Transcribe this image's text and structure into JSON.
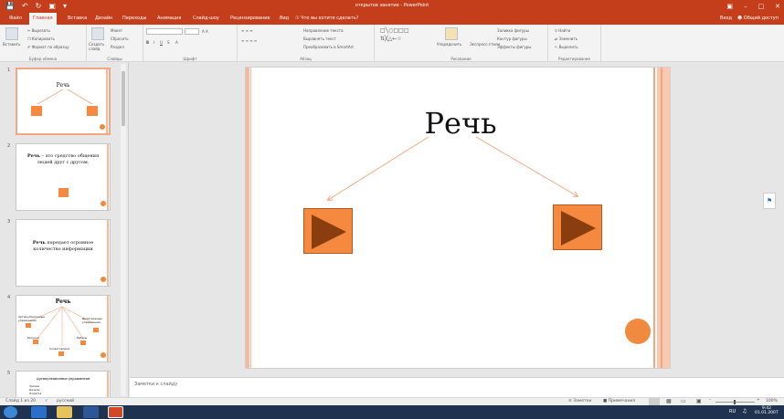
{
  "window": {
    "title": "открытое занятие - PowerPoint"
  },
  "tabs": [
    "Файл",
    "Главная",
    "Вставка",
    "Дизайн",
    "Переходы",
    "Анимация",
    "Слайд-шоу",
    "Рецензирование",
    "Вид",
    "Что вы хотите сделать?"
  ],
  "account": {
    "signin": "Вход",
    "share": "Общий доступ"
  },
  "ribbon": {
    "clipboard": {
      "paste": "Вставить",
      "cut": "Вырезать",
      "copy": "Копировать",
      "format": "Формат по образцу",
      "label": "Буфер обмена"
    },
    "slides": {
      "new_slide": "Создать слайд",
      "layout": "Макет",
      "reset": "Сбросить",
      "section": "Раздел",
      "label": "Слайды"
    },
    "font": {
      "label": "Шрифт"
    },
    "paragraph": {
      "text_dir": "Направление текста",
      "align": "Выровнять текст",
      "smartart": "Преобразовать в SmartArt",
      "label": "Абзац"
    },
    "drawing": {
      "arrange": "Упорядочить",
      "styles": "Экспресс-стили",
      "fill": "Заливка фигуры",
      "outline": "Контур фигуры",
      "effects": "Эффекты фигуры",
      "label": "Рисование"
    },
    "editing": {
      "find": "Найти",
      "replace": "Заменить",
      "select": "Выделить",
      "label": "Редактирование"
    }
  },
  "thumbnails": [
    {
      "num": "1",
      "title": "Речь"
    },
    {
      "num": "2",
      "text_bold": "Речь",
      "text": " – это средство общения людей друг с другом."
    },
    {
      "num": "3",
      "text_bold": "Речь",
      "text": " передает огромное количество информации"
    },
    {
      "num": "4",
      "title": "Речь",
      "items": [
        "Артикуляционные упражнения",
        "Дыхательные упражнения",
        "Рисунки",
        "Скороговорки",
        "Ребусы"
      ]
    },
    {
      "num": "5",
      "title": "Артикуляционные упражнения",
      "items": [
        "Часики",
        "Качели",
        "Лопатка"
      ]
    }
  ],
  "slide": {
    "title": "Речь"
  },
  "notes": {
    "placeholder": "Заметки к слайду"
  },
  "status": {
    "slide": "Слайд 1 из 20",
    "lang": "русский",
    "notes": "Заметки",
    "comments": "Примечания",
    "zoom": "100%"
  },
  "taskbar": {
    "lang": "RU",
    "time": "9:42",
    "date": "01.01.2007"
  },
  "colors": {
    "accent": "#c43e1c",
    "shape": "#f5893f",
    "arrow": "#f4a582"
  }
}
